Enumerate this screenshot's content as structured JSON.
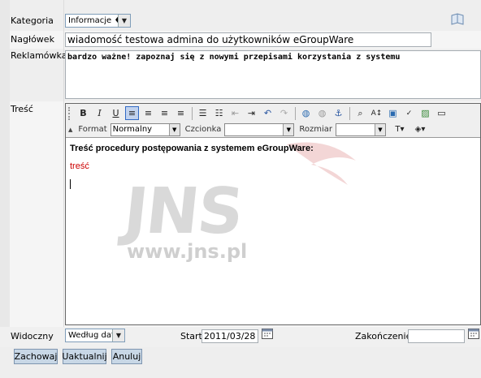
{
  "category": {
    "label": "Kategoria",
    "value": "Informacje ♦"
  },
  "headline": {
    "label": "Nagłówek",
    "value": "wiadomość testowa admina do użytkowników eGroupWare"
  },
  "teaser": {
    "label": "Reklamówka",
    "value": "bardzo ważne! zapoznaj się z nowymi przepisami korzystania z systemu"
  },
  "content": {
    "label": "Treść",
    "heading": "Treść procedury postępowania z systemem eGroupWare:",
    "body": "treść"
  },
  "toolbar": {
    "format_label": "Format",
    "format_value": "Normalny",
    "font_label": "Czcionka",
    "font_value": "",
    "size_label": "Rozmiar",
    "size_value": ""
  },
  "watermark": {
    "logo": "JNS",
    "url": "www.jns.pl"
  },
  "visibility": {
    "label": "Widoczny",
    "value": "Według daty"
  },
  "start": {
    "label": "Start",
    "value": "2011/03/28"
  },
  "end": {
    "label": "Zakończenie",
    "value": ""
  },
  "actions": {
    "save": "Zachowaj",
    "update": "Uaktualnij",
    "cancel": "Anuluj"
  },
  "colors": {
    "label_band": "#f0f0f0",
    "accent_button": "#c8d7e6",
    "content_body": "#cc0000",
    "gutter": "#e8e8e8"
  }
}
